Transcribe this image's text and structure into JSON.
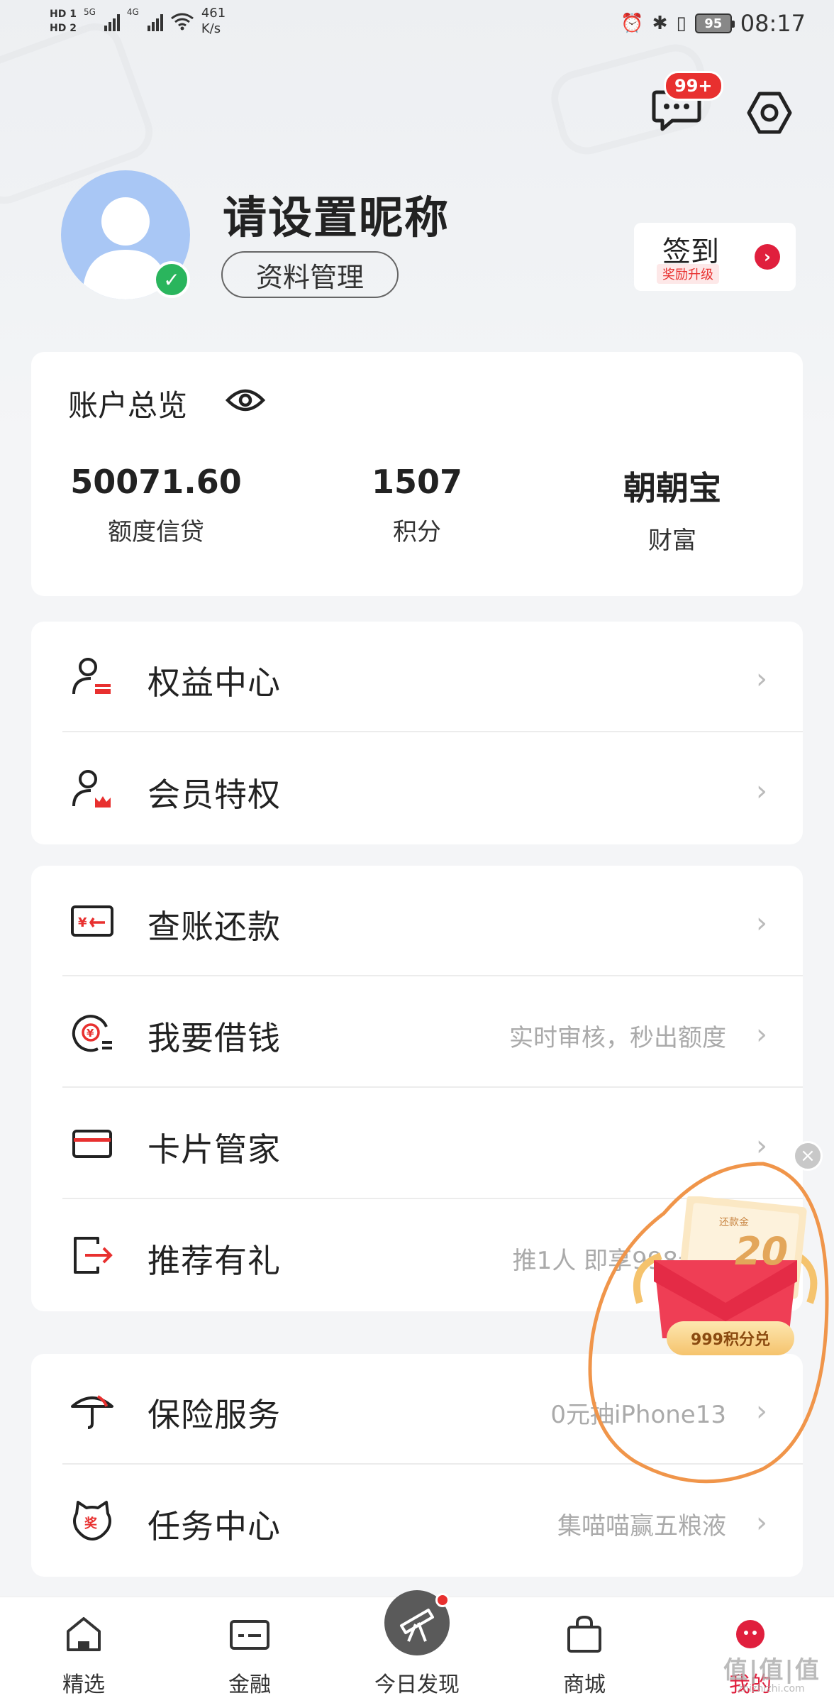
{
  "status_bar": {
    "sim1": "HD 1",
    "sim2": "HD 2",
    "net1": "5G",
    "net2": "4G",
    "speed_value": "461",
    "speed_unit": "K/s",
    "battery": "95",
    "time": "08:17"
  },
  "header": {
    "message_badge": "99+",
    "message_icon": "chat-bubble-icon",
    "settings_icon": "hexagon-gear-icon"
  },
  "profile": {
    "nickname": "请设置昵称",
    "manage_label": "资料管理",
    "verified_icon": "check-icon",
    "checkin_label": "签到",
    "checkin_tag": "奖励升级"
  },
  "overview": {
    "title": "账户总览",
    "stats": [
      {
        "value": "50071.60",
        "label": "额度信贷"
      },
      {
        "value": "1507",
        "label": "积分"
      },
      {
        "value": "朝朝宝",
        "label": "财富"
      }
    ]
  },
  "menu_groups": [
    {
      "items": [
        {
          "label": "权益中心",
          "desc": "",
          "icon": "user-card-icon"
        },
        {
          "label": "会员特权",
          "desc": "",
          "icon": "user-crown-icon"
        }
      ]
    },
    {
      "items": [
        {
          "label": "查账还款",
          "desc": "",
          "icon": "bill-card-icon"
        },
        {
          "label": "我要借钱",
          "desc": "实时审核，秒出额度",
          "icon": "yuan-coin-icon"
        },
        {
          "label": "卡片管家",
          "desc": "",
          "icon": "card-icon"
        },
        {
          "label": "推荐有礼",
          "desc": "推1人 即享998元奉",
          "icon": "share-exit-icon"
        }
      ]
    },
    {
      "items": [
        {
          "label": "保险服务",
          "desc": "0元抽iPhone13",
          "icon": "umbrella-icon"
        },
        {
          "label": "任务中心",
          "desc": "集喵喵赢五粮液",
          "icon": "prize-cat-icon"
        }
      ]
    }
  ],
  "promo": {
    "tag": "还款金",
    "amount": "20",
    "button": "999积分兑"
  },
  "tabbar": {
    "tabs": [
      {
        "label": "精选",
        "icon": "home-icon"
      },
      {
        "label": "金融",
        "icon": "card-icon"
      },
      {
        "label": "今日发现",
        "icon": "telescope-icon"
      },
      {
        "label": "商城",
        "icon": "bag-icon"
      },
      {
        "label": "我的",
        "icon": "profile-face-icon"
      }
    ]
  },
  "watermark": {
    "main": "值|值|值",
    "sub": "zhizhizhi.com"
  },
  "colors": {
    "accent": "#e01f3d",
    "badge": "#e8302f",
    "verified": "#2ab55d",
    "annotation": "#f0954a"
  }
}
